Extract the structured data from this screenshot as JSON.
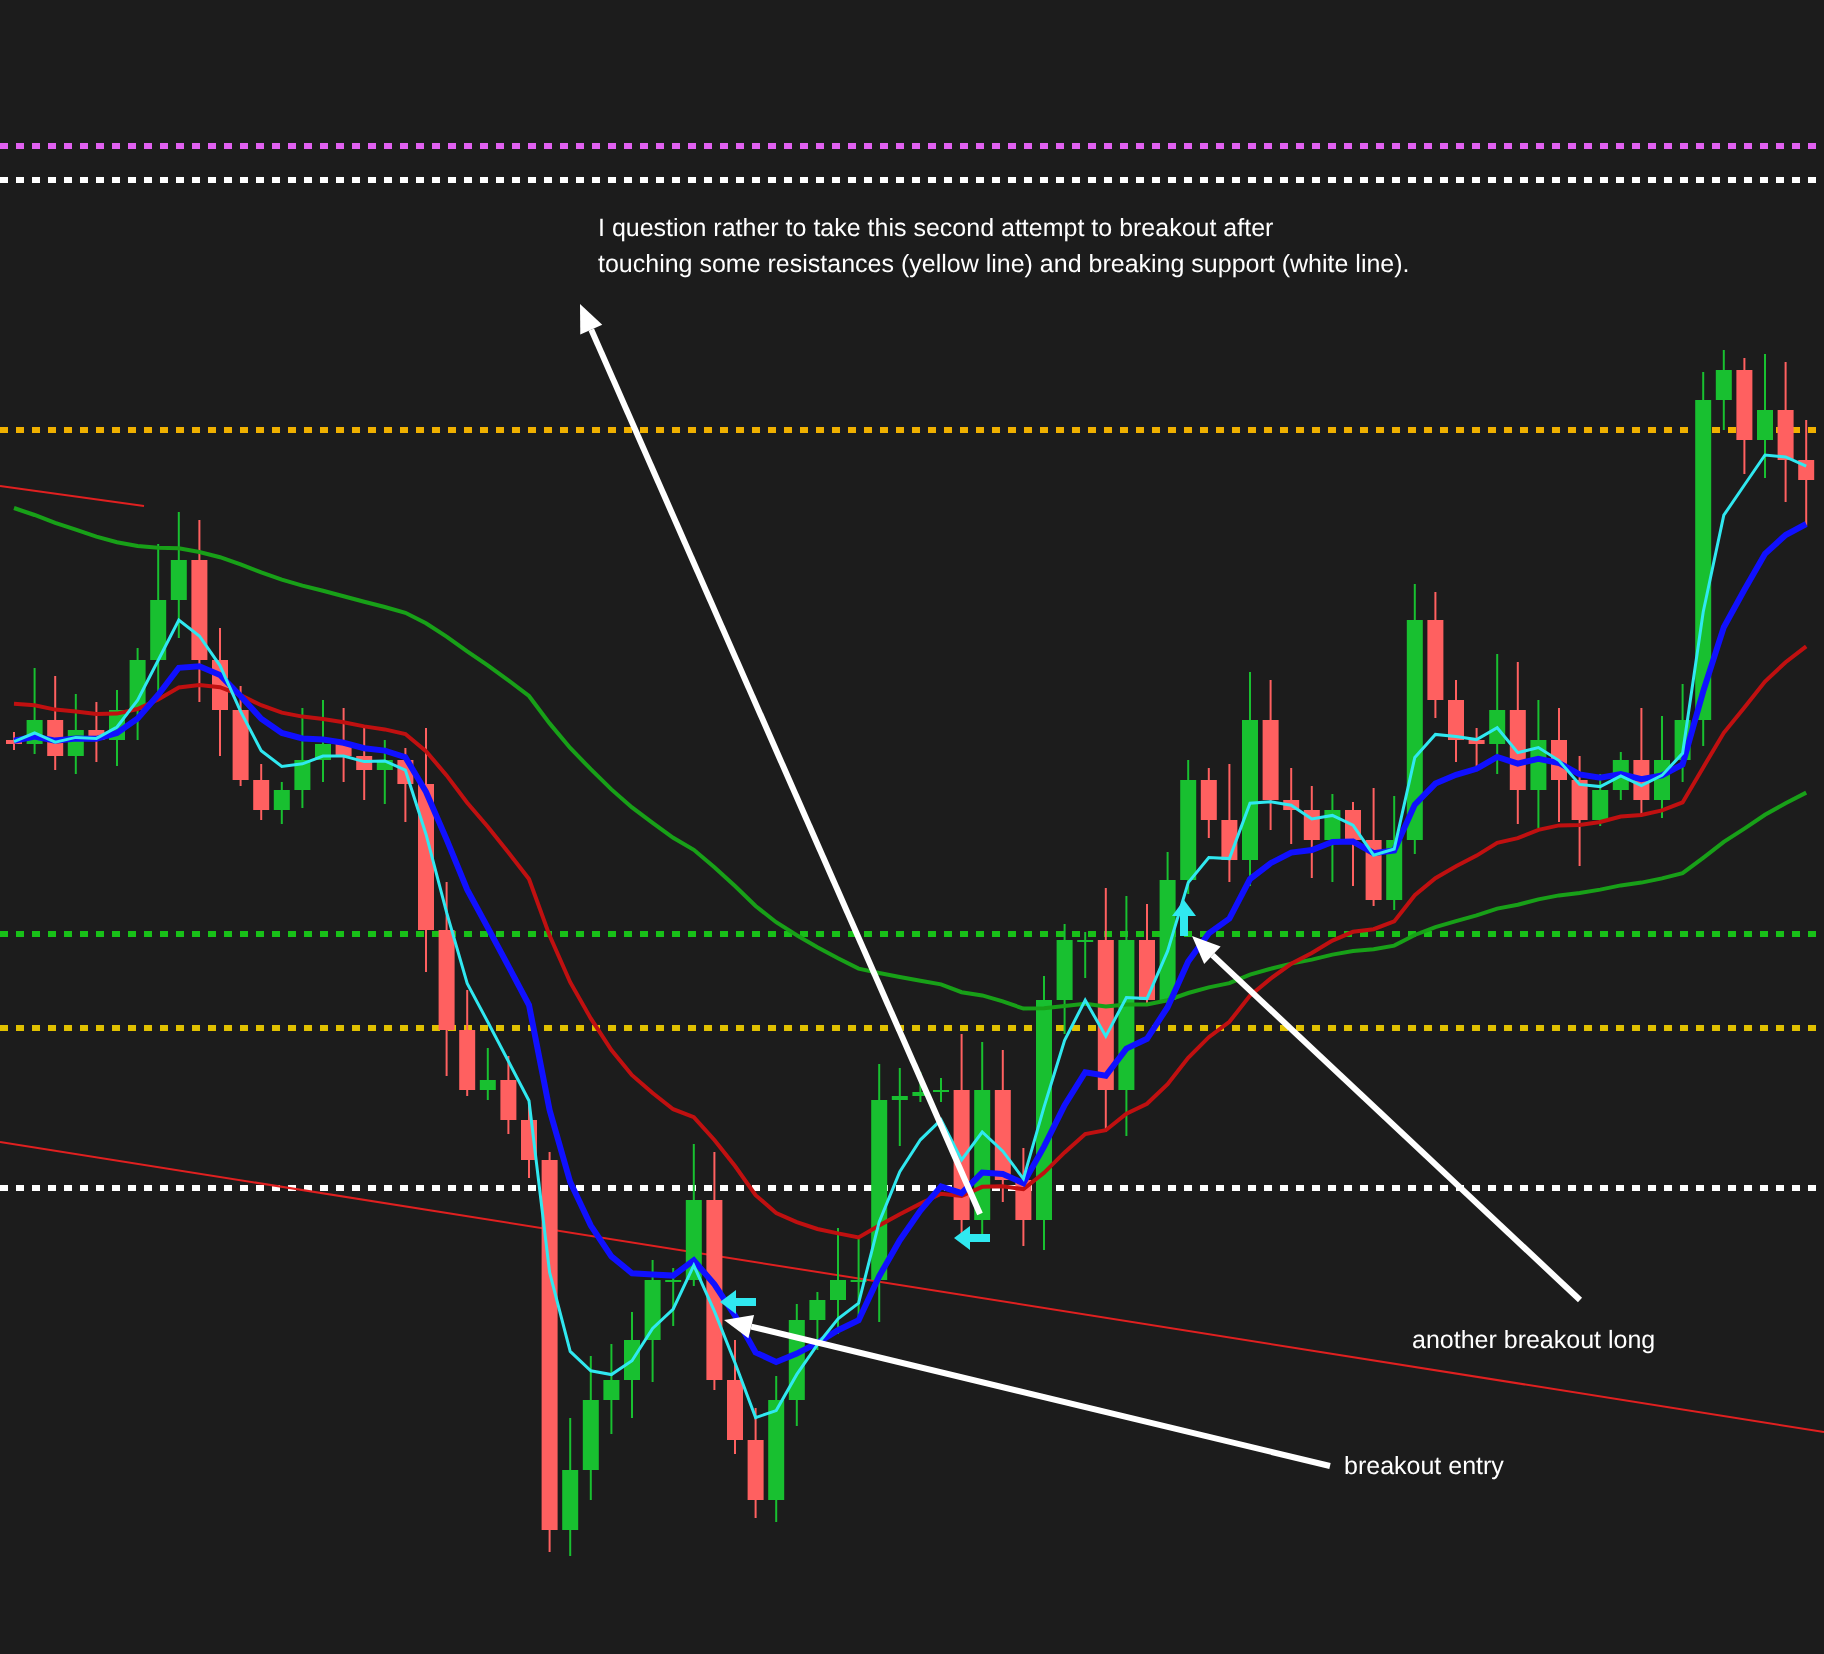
{
  "notes": [
    {
      "lines": [
        "I question rather to take this second attempt to breakout after",
        "touching some resistances (yellow line) and breaking support (white line)."
      ]
    },
    {
      "lines": [
        "another breakout long"
      ]
    },
    {
      "lines": [
        "breakout entry"
      ]
    }
  ]
}
